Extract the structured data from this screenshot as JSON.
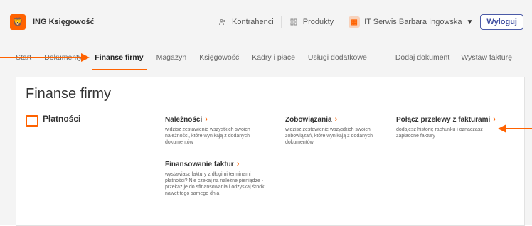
{
  "header": {
    "app_title": "ING Księgowość",
    "contractors": "Kontrahenci",
    "products": "Produkty",
    "company": "IT Serwis Barbara Ingowska",
    "logout": "Wyloguj"
  },
  "nav": {
    "items": [
      "Start",
      "Dokumenty",
      "Finanse firmy",
      "Magazyn",
      "Księgowość",
      "Kadry i płace",
      "Usługi dodatkowe"
    ],
    "right": [
      "Dodaj dokument",
      "Wystaw fakturę"
    ]
  },
  "page": {
    "title": "Finanse firmy",
    "section": "Płatności",
    "cards": [
      {
        "title": "Należności",
        "desc": "widzisz zestawienie wszystkich swoich należności, które wynikają z dodanych dokumentów"
      },
      {
        "title": "Zobowiązania",
        "desc": "widzisz zestawienie wszystkich swoich zobowiązań, które wynikają z dodanych dokumentów"
      },
      {
        "title": "Połącz przelewy z fakturami",
        "desc": "dodajesz historię rachunku i oznaczasz zapłacone faktury"
      },
      {
        "title": "Finansowanie faktur",
        "desc": "wystawiasz faktury z długimi terminami płatności? Nie czekaj na należne pieniądze - przekaż je do sfinansowania i odzyskaj środki nawet tego samego dnia"
      }
    ]
  },
  "icons": {
    "contractors": "people-icon",
    "products": "grid-icon",
    "company": "building-icon",
    "section": "wallet-icon"
  },
  "colors": {
    "accent": "#ff6200",
    "logout_border": "#4b5aa7"
  }
}
